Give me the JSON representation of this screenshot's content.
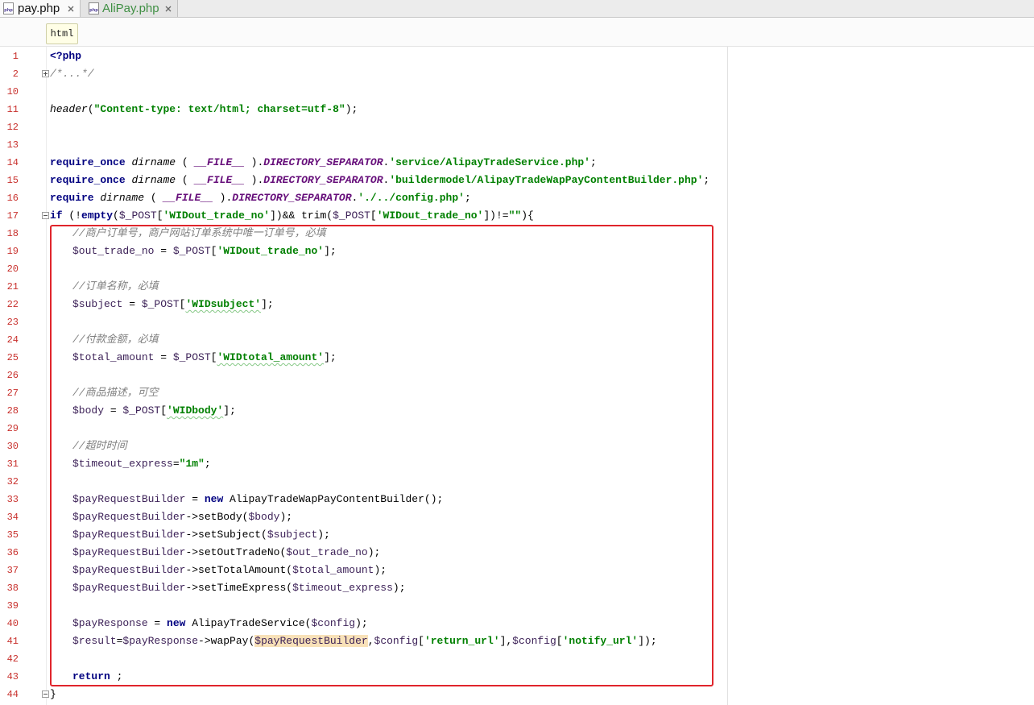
{
  "tabs": [
    {
      "label": "pay.php",
      "icon": "php-file-icon",
      "icon_text": "php",
      "active": true
    },
    {
      "label": "AliPay.php",
      "icon": "php-file-icon",
      "icon_text": "php",
      "active": false
    }
  ],
  "breadcrumb": {
    "items": [
      "html"
    ]
  },
  "colors": {
    "line_number": "#c8302c",
    "keyword": "#000080",
    "string": "#008000",
    "comment": "#808080",
    "constant": "#660e7a",
    "variable": "#3d2258",
    "caret_identifier_bg": "#f8e1b8",
    "highlight_box": "#e0252c",
    "modified_tab_label": "#3f8f43"
  },
  "editor": {
    "lines": [
      {
        "n": 1,
        "t": [
          "<?php"
        ]
      },
      {
        "n": 2,
        "t": [
          "/*...*/"
        ]
      },
      {
        "n": 10,
        "t": []
      },
      {
        "n": 11,
        "t": [
          "header",
          "(",
          "\"Content-type: text/html; charset=utf-8\"",
          ");"
        ]
      },
      {
        "n": 12,
        "t": []
      },
      {
        "n": 13,
        "t": []
      },
      {
        "n": 14,
        "t": [
          "require_once",
          " ",
          "dirname",
          " ( ",
          "__FILE__",
          " ).",
          "DIRECTORY_SEPARATOR",
          ".",
          "'service/AlipayTradeService.php'",
          ";"
        ]
      },
      {
        "n": 15,
        "t": [
          "require_once",
          " ",
          "dirname",
          " ( ",
          "__FILE__",
          " ).",
          "DIRECTORY_SEPARATOR",
          ".",
          "'buildermodel/AlipayTradeWapPayContentBuilder.php'",
          ";"
        ]
      },
      {
        "n": 16,
        "t": [
          "require",
          " ",
          "dirname",
          " ( ",
          "__FILE__",
          " ).",
          "DIRECTORY_SEPARATOR",
          ".",
          "'./../config.php'",
          ";"
        ]
      },
      {
        "n": 17,
        "t": [
          "if",
          " (!",
          "empty",
          "(",
          "$_POST",
          "[",
          "'WIDout_trade_no'",
          "])&& trim(",
          "$_POST",
          "[",
          "'WIDout_trade_no'",
          "])!=",
          "\"\"",
          "){"
        ]
      },
      {
        "n": 18,
        "t": [
          "//商户订单号，商户网站订单系统中唯一订单号，必填"
        ]
      },
      {
        "n": 19,
        "t": [
          "$out_trade_no",
          " = ",
          "$_POST",
          "[",
          "'WIDout_trade_no'",
          "];"
        ]
      },
      {
        "n": 20,
        "t": []
      },
      {
        "n": 21,
        "t": [
          "//订单名称，必填"
        ]
      },
      {
        "n": 22,
        "t": [
          "$subject",
          " = ",
          "$_POST",
          "[",
          "'WIDsubject'",
          "];"
        ]
      },
      {
        "n": 23,
        "t": []
      },
      {
        "n": 24,
        "t": [
          "//付款金额，必填"
        ]
      },
      {
        "n": 25,
        "t": [
          "$total_amount",
          " = ",
          "$_POST",
          "[",
          "'WIDtotal_amount'",
          "];"
        ]
      },
      {
        "n": 26,
        "t": []
      },
      {
        "n": 27,
        "t": [
          "//商品描述，可空"
        ]
      },
      {
        "n": 28,
        "t": [
          "$body",
          " = ",
          "$_POST",
          "[",
          "'WIDbody'",
          "];"
        ]
      },
      {
        "n": 29,
        "t": []
      },
      {
        "n": 30,
        "t": [
          "//超时时间"
        ]
      },
      {
        "n": 31,
        "t": [
          "$timeout_express",
          "=",
          "\"1m\"",
          ";"
        ]
      },
      {
        "n": 32,
        "t": []
      },
      {
        "n": 33,
        "t": [
          "$payRequestBuilder",
          " = ",
          "new",
          " AlipayTradeWapPayContentBuilder();"
        ]
      },
      {
        "n": 34,
        "t": [
          "$payRequestBuilder",
          "->setBody(",
          "$body",
          ");"
        ]
      },
      {
        "n": 35,
        "t": [
          "$payRequestBuilder",
          "->setSubject(",
          "$subject",
          ");"
        ]
      },
      {
        "n": 36,
        "t": [
          "$payRequestBuilder",
          "->setOutTradeNo(",
          "$out_trade_no",
          ");"
        ]
      },
      {
        "n": 37,
        "t": [
          "$payRequestBuilder",
          "->setTotalAmount(",
          "$total_amount",
          ");"
        ]
      },
      {
        "n": 38,
        "t": [
          "$payRequestBuilder",
          "->setTimeExpress(",
          "$timeout_express",
          ");"
        ]
      },
      {
        "n": 39,
        "t": []
      },
      {
        "n": 40,
        "t": [
          "$payResponse",
          " = ",
          "new",
          " AlipayTradeService(",
          "$config",
          ");"
        ]
      },
      {
        "n": 41,
        "t": [
          "$result",
          "=",
          "$payResponse",
          "->wapPay(",
          "$payRequestBuilder",
          ",",
          "$config",
          "[",
          "'return_url'",
          "],",
          "$config",
          "[",
          "'notify_url'",
          "]);"
        ]
      },
      {
        "n": 42,
        "t": []
      },
      {
        "n": 43,
        "t": [
          "return",
          " ;"
        ]
      },
      {
        "n": 44,
        "t": [
          "}"
        ]
      }
    ]
  }
}
